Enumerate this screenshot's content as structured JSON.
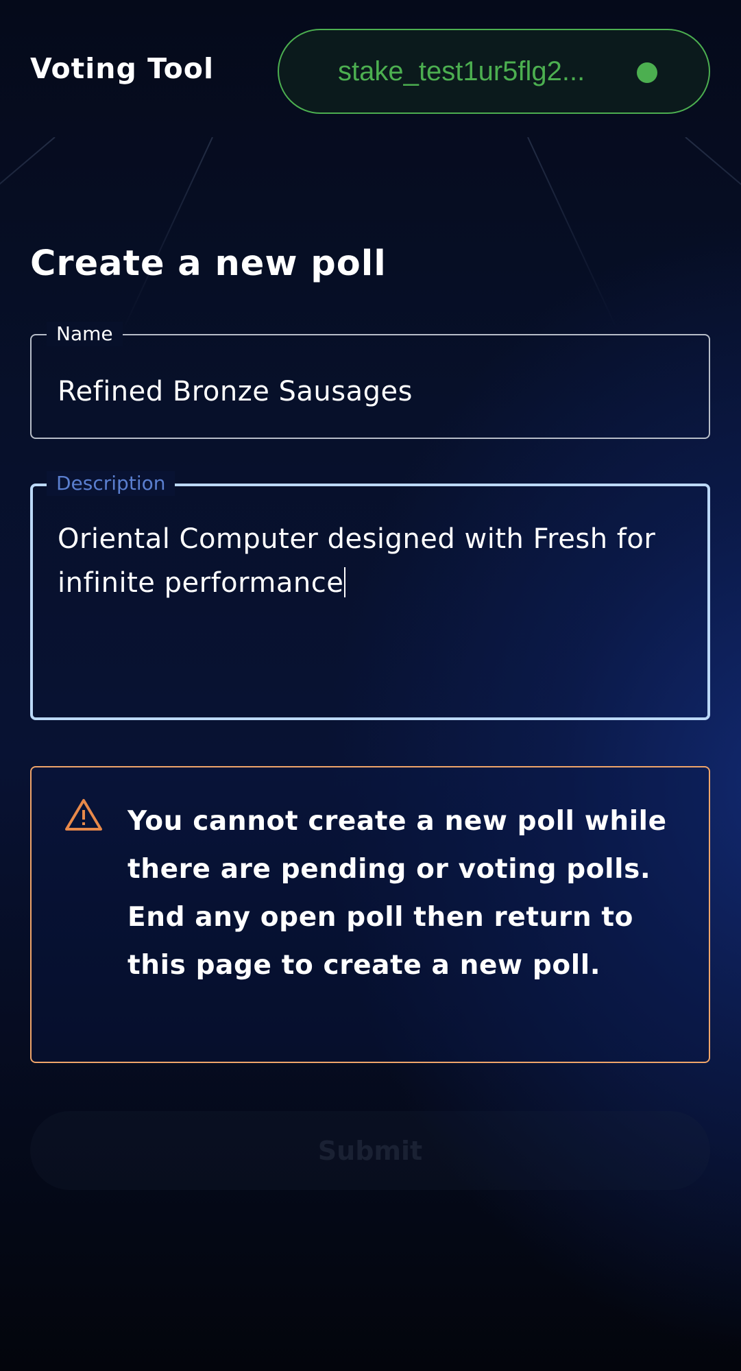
{
  "header": {
    "app_title": "Voting Tool",
    "wallet_address": "stake_test1ur5flg2...",
    "wallet_status_color": "#4caf50"
  },
  "page": {
    "title": "Create a new poll"
  },
  "form": {
    "name": {
      "label": "Name",
      "value": "Refined Bronze Sausages"
    },
    "description": {
      "label": "Description",
      "value": "Oriental Computer designed with Fresh for infinite performance"
    }
  },
  "alert": {
    "icon": "warning-triangle-icon",
    "color": "#f0a56a",
    "message": "You cannot create a new poll while there are pending or voting polls. End any open poll then return to this page to create a new poll."
  },
  "actions": {
    "submit_label": "Submit"
  }
}
